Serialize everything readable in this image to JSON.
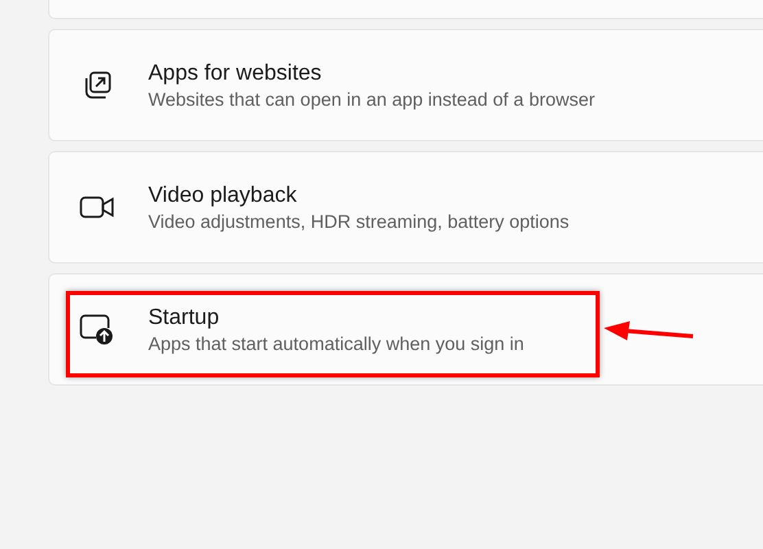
{
  "cards": [
    {
      "title": "Apps for websites",
      "subtitle": "Websites that can open in an app instead of a browser",
      "highlighted": false
    },
    {
      "title": "Video playback",
      "subtitle": "Video adjustments, HDR streaming, battery options",
      "highlighted": false
    },
    {
      "title": "Startup",
      "subtitle": "Apps that start automatically when you sign in",
      "highlighted": true
    }
  ]
}
